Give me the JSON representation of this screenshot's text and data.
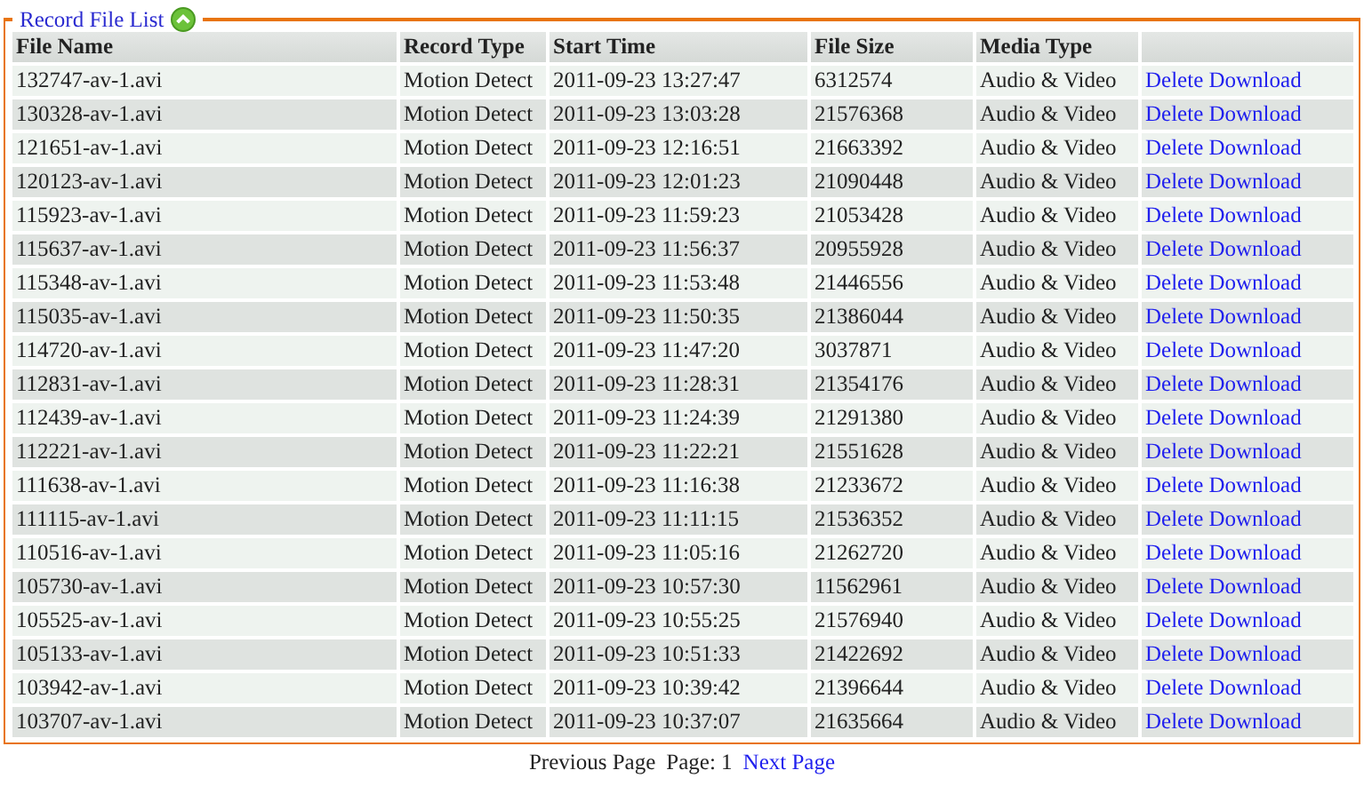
{
  "panel": {
    "title": "Record File List"
  },
  "table": {
    "columns": [
      "File Name",
      "Record Type",
      "Start Time",
      "File Size",
      "Media Type"
    ],
    "rows": [
      {
        "file_name": "132747-av-1.avi",
        "record_type": "Motion Detect",
        "start_time": "2011-09-23 13:27:47",
        "file_size": "6312574",
        "media_type": "Audio & Video",
        "actions": [
          "Delete",
          "Download"
        ]
      },
      {
        "file_name": "130328-av-1.avi",
        "record_type": "Motion Detect",
        "start_time": "2011-09-23 13:03:28",
        "file_size": "21576368",
        "media_type": "Audio & Video",
        "actions": [
          "Delete",
          "Download"
        ]
      },
      {
        "file_name": "121651-av-1.avi",
        "record_type": "Motion Detect",
        "start_time": "2011-09-23 12:16:51",
        "file_size": "21663392",
        "media_type": "Audio & Video",
        "actions": [
          "Delete",
          "Download"
        ]
      },
      {
        "file_name": "120123-av-1.avi",
        "record_type": "Motion Detect",
        "start_time": "2011-09-23 12:01:23",
        "file_size": "21090448",
        "media_type": "Audio & Video",
        "actions": [
          "Delete",
          "Download"
        ]
      },
      {
        "file_name": "115923-av-1.avi",
        "record_type": "Motion Detect",
        "start_time": "2011-09-23 11:59:23",
        "file_size": "21053428",
        "media_type": "Audio & Video",
        "actions": [
          "Delete",
          "Download"
        ]
      },
      {
        "file_name": "115637-av-1.avi",
        "record_type": "Motion Detect",
        "start_time": "2011-09-23 11:56:37",
        "file_size": "20955928",
        "media_type": "Audio & Video",
        "actions": [
          "Delete",
          "Download"
        ]
      },
      {
        "file_name": "115348-av-1.avi",
        "record_type": "Motion Detect",
        "start_time": "2011-09-23 11:53:48",
        "file_size": "21446556",
        "media_type": "Audio & Video",
        "actions": [
          "Delete",
          "Download"
        ]
      },
      {
        "file_name": "115035-av-1.avi",
        "record_type": "Motion Detect",
        "start_time": "2011-09-23 11:50:35",
        "file_size": "21386044",
        "media_type": "Audio & Video",
        "actions": [
          "Delete",
          "Download"
        ]
      },
      {
        "file_name": "114720-av-1.avi",
        "record_type": "Motion Detect",
        "start_time": "2011-09-23 11:47:20",
        "file_size": "3037871",
        "media_type": "Audio & Video",
        "actions": [
          "Delete",
          "Download"
        ]
      },
      {
        "file_name": "112831-av-1.avi",
        "record_type": "Motion Detect",
        "start_time": "2011-09-23 11:28:31",
        "file_size": "21354176",
        "media_type": "Audio & Video",
        "actions": [
          "Delete",
          "Download"
        ]
      },
      {
        "file_name": "112439-av-1.avi",
        "record_type": "Motion Detect",
        "start_time": "2011-09-23 11:24:39",
        "file_size": "21291380",
        "media_type": "Audio & Video",
        "actions": [
          "Delete",
          "Download"
        ]
      },
      {
        "file_name": "112221-av-1.avi",
        "record_type": "Motion Detect",
        "start_time": "2011-09-23 11:22:21",
        "file_size": "21551628",
        "media_type": "Audio & Video",
        "actions": [
          "Delete",
          "Download"
        ]
      },
      {
        "file_name": "111638-av-1.avi",
        "record_type": "Motion Detect",
        "start_time": "2011-09-23 11:16:38",
        "file_size": "21233672",
        "media_type": "Audio & Video",
        "actions": [
          "Delete",
          "Download"
        ]
      },
      {
        "file_name": "111115-av-1.avi",
        "record_type": "Motion Detect",
        "start_time": "2011-09-23 11:11:15",
        "file_size": "21536352",
        "media_type": "Audio & Video",
        "actions": [
          "Delete",
          "Download"
        ]
      },
      {
        "file_name": "110516-av-1.avi",
        "record_type": "Motion Detect",
        "start_time": "2011-09-23 11:05:16",
        "file_size": "21262720",
        "media_type": "Audio & Video",
        "actions": [
          "Delete",
          "Download"
        ]
      },
      {
        "file_name": "105730-av-1.avi",
        "record_type": "Motion Detect",
        "start_time": "2011-09-23 10:57:30",
        "file_size": "11562961",
        "media_type": "Audio & Video",
        "actions": [
          "Delete",
          "Download"
        ]
      },
      {
        "file_name": "105525-av-1.avi",
        "record_type": "Motion Detect",
        "start_time": "2011-09-23 10:55:25",
        "file_size": "21576940",
        "media_type": "Audio & Video",
        "actions": [
          "Delete",
          "Download"
        ]
      },
      {
        "file_name": "105133-av-1.avi",
        "record_type": "Motion Detect",
        "start_time": "2011-09-23 10:51:33",
        "file_size": "21422692",
        "media_type": "Audio & Video",
        "actions": [
          "Delete",
          "Download"
        ]
      },
      {
        "file_name": "103942-av-1.avi",
        "record_type": "Motion Detect",
        "start_time": "2011-09-23 10:39:42",
        "file_size": "21396644",
        "media_type": "Audio & Video",
        "actions": [
          "Delete",
          "Download"
        ]
      },
      {
        "file_name": "103707-av-1.avi",
        "record_type": "Motion Detect",
        "start_time": "2011-09-23 10:37:07",
        "file_size": "21635664",
        "media_type": "Audio & Video",
        "actions": [
          "Delete",
          "Download"
        ]
      }
    ]
  },
  "pagination": {
    "previous": {
      "label": "Previous Page",
      "disabled": true
    },
    "page": "Page: 1",
    "next": {
      "label": "Next Page",
      "disabled": false
    }
  }
}
